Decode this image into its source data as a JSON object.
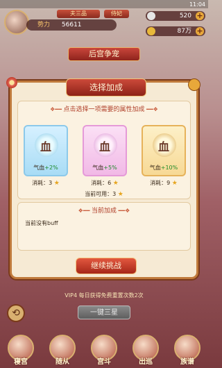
{
  "status": {
    "time": "11:04"
  },
  "hud": {
    "tag1": "夫三品",
    "tag2": "侍妃",
    "power_label": "势力",
    "power_value": "56611",
    "silver": "520",
    "gold": "87万"
  },
  "page_title": "后宫争宠",
  "modal": {
    "title": "选择加成",
    "prompt": "点击选择一项需要的属性加成",
    "cards": [
      {
        "glyph": "血",
        "effect_label": "气血",
        "effect_value": "+2%",
        "cost_label": "消耗：",
        "cost_value": "3"
      },
      {
        "glyph": "血",
        "effect_label": "气血",
        "effect_value": "+5%",
        "cost_label": "消耗：",
        "cost_value": "6"
      },
      {
        "glyph": "血",
        "effect_label": "气血",
        "effect_value": "+10%",
        "cost_label": "消耗：",
        "cost_value": "9"
      }
    ],
    "available_label": "当前可用：",
    "available_value": "3",
    "current_title": "当前加成",
    "current_text": "当前没有buff",
    "continue_label": "继续挑战"
  },
  "vip_note": "VIP4 每日获得免费重置次数2次",
  "sweep_label": "一键三星",
  "nav": [
    "寝宫",
    "随从",
    "宫斗",
    "出巡",
    "族谱"
  ]
}
